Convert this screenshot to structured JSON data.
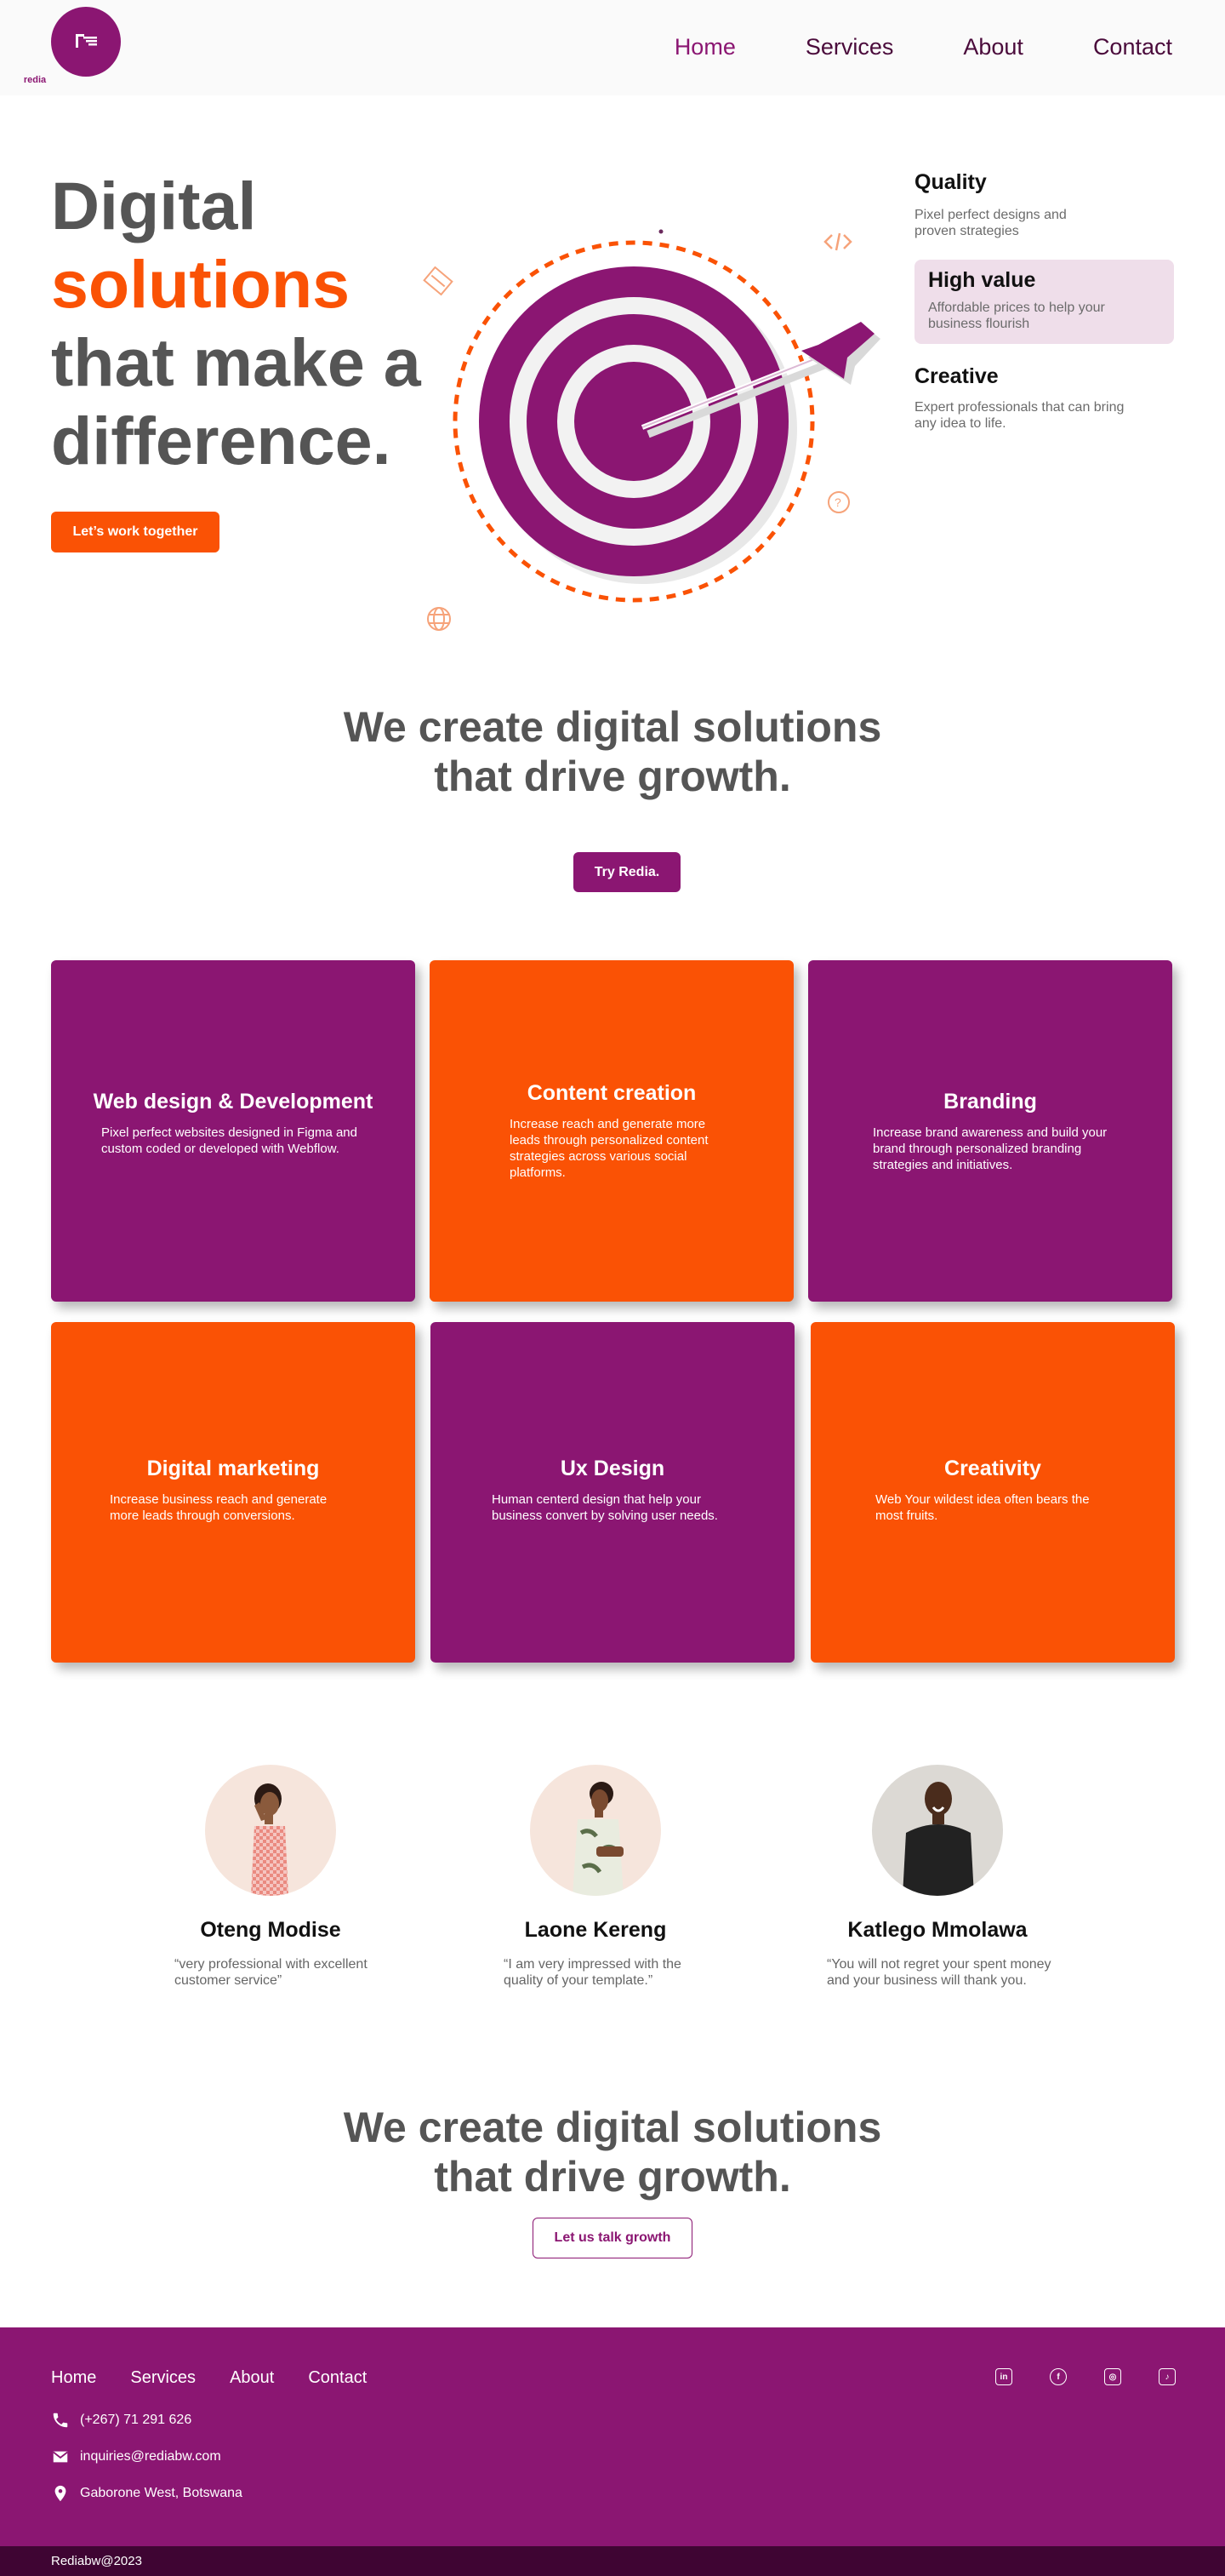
{
  "brand": {
    "logo_text": "redia",
    "purple": "#8b1672",
    "orange": "#fa5205"
  },
  "nav": {
    "items": [
      {
        "label": "Home"
      },
      {
        "label": "Services"
      },
      {
        "label": "About"
      },
      {
        "label": "Contact"
      }
    ],
    "active": "Home"
  },
  "hero": {
    "title_line1": "Digital",
    "title_line2": "solutions",
    "title_line3": "that make a",
    "title_line4": "difference.",
    "cta": "Let’s work together"
  },
  "features": [
    {
      "title": "Quality",
      "text": "Pixel perfect designs and proven strategies"
    },
    {
      "title": "High value",
      "text": "Affordable prices  to help your business flourish"
    },
    {
      "title": "Creative",
      "text": "Expert  professionals that can bring any idea to life."
    }
  ],
  "growth": {
    "line1": "We create digital solutions",
    "line2": "that drive growth.",
    "cta": "Try Redia."
  },
  "services": [
    {
      "title": "Web design & Development",
      "text": "Pixel perfect  websites  designed in Figma and custom coded or developed with Webflow.",
      "color": "purple"
    },
    {
      "title": "Content creation",
      "text": "Increase  reach and generate more  leads through personalized content strategies across various social platforms.",
      "color": "orange"
    },
    {
      "title": "Branding",
      "text": "Increase brand awareness and build your brand through personalized branding strategies and initiatives.",
      "color": "purple"
    },
    {
      "title": "Digital marketing",
      "text": "Increase business reach and generate more leads through conversions.",
      "color": "orange"
    },
    {
      "title": "Ux Design",
      "text": "Human centerd design that help your business convert by solving user needs.",
      "color": "purple"
    },
    {
      "title": "Creativity",
      "text": "Web Your wildest idea often bears the most fruits.",
      "color": "orange"
    }
  ],
  "testimonials": [
    {
      "name": "Oteng Modise",
      "quote": "“very professional with excellent customer service”"
    },
    {
      "name": "Laone Kereng",
      "quote": "“I am  very impressed with the quality of your template.”"
    },
    {
      "name": "Katlego Mmolawa",
      "quote": "“You will not regret your spent money and your business will thank you."
    }
  ],
  "growth2": {
    "line1": "We create digital solutions",
    "line2": "that drive growth.",
    "cta": "Let us talk growth"
  },
  "footer": {
    "links": [
      {
        "label": "Home"
      },
      {
        "label": "Services"
      },
      {
        "label": "About"
      },
      {
        "label": "Contact"
      }
    ],
    "phone": "(+267) 71 291 626",
    "email": "inquiries@rediabw.com",
    "address": "Gaborone West, Botswana",
    "socials": [
      {
        "icon": "linkedin-icon",
        "glyph": "in"
      },
      {
        "icon": "facebook-icon",
        "glyph": "f"
      },
      {
        "icon": "instagram-icon",
        "glyph": "◎"
      },
      {
        "icon": "tiktok-icon",
        "glyph": "♪"
      }
    ],
    "copyright": "Rediabw@2023"
  }
}
